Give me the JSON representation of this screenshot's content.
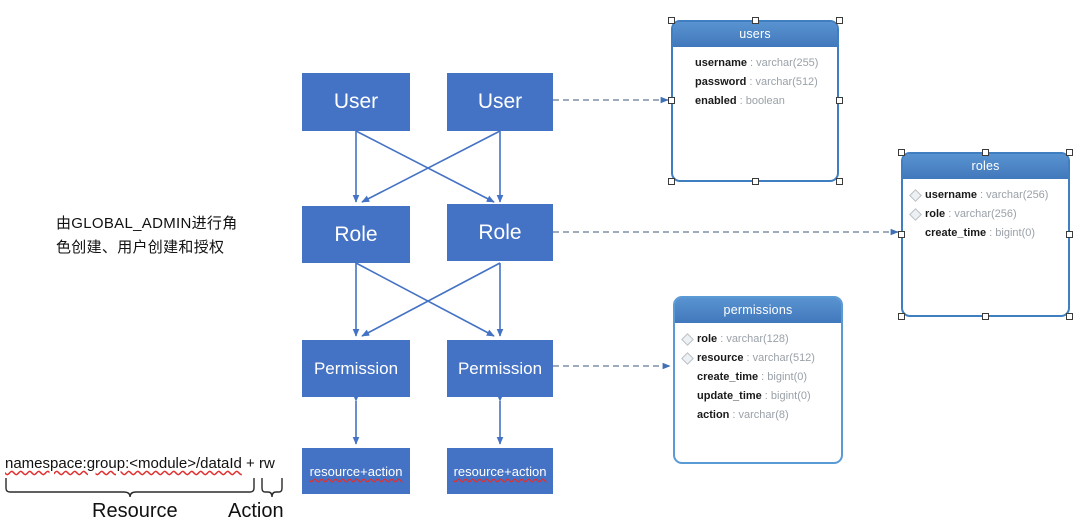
{
  "diagram": {
    "title": "RBAC permission model diagram",
    "colors": {
      "node_fill": "#4472C4",
      "table_header": "#4a86c8",
      "table_border": "#5B9BD5",
      "edge": "#4472C4",
      "dashed_edge": "#7f8fa6",
      "spellcheck": "#e03030"
    }
  },
  "flow": {
    "user_left": "User",
    "user_right": "User",
    "role_left": "Role",
    "role_right": "Role",
    "permission_left": "Permission",
    "permission_right": "Permission",
    "leaf_left": "resource+action",
    "leaf_right": "resource+action"
  },
  "annotation": {
    "admin_note": "由GLOBAL_ADMIN进行角色创建、用户创建和授权",
    "admin_note_line1": "由GLOBAL_ADMIN进行角",
    "admin_note_line2": "色创建、用户创建和授权",
    "formula_resource": "namespace:group:<module>/dataId",
    "formula_sep": " + ",
    "formula_action": "rw",
    "brace_resource_label": "Resource",
    "brace_action_label": "Action"
  },
  "tables": [
    {
      "name": "users",
      "selected": true,
      "fields": [
        {
          "key": false,
          "name": "username",
          "type": "varchar(255)"
        },
        {
          "key": false,
          "name": "password",
          "type": "varchar(512)"
        },
        {
          "key": false,
          "name": "enabled",
          "type": "boolean"
        }
      ]
    },
    {
      "name": "roles",
      "selected": true,
      "fields": [
        {
          "key": true,
          "name": "username",
          "type": "varchar(256)"
        },
        {
          "key": true,
          "name": "role",
          "type": "varchar(256)"
        },
        {
          "key": false,
          "name": "create_time",
          "type": "bigint(0)"
        }
      ]
    },
    {
      "name": "permissions",
      "selected": false,
      "fields": [
        {
          "key": true,
          "name": "role",
          "type": "varchar(128)"
        },
        {
          "key": true,
          "name": "resource",
          "type": "varchar(512)"
        },
        {
          "key": false,
          "name": "create_time",
          "type": "bigint(0)"
        },
        {
          "key": false,
          "name": "update_time",
          "type": "bigint(0)"
        },
        {
          "key": false,
          "name": "action",
          "type": "varchar(8)"
        }
      ]
    }
  ]
}
